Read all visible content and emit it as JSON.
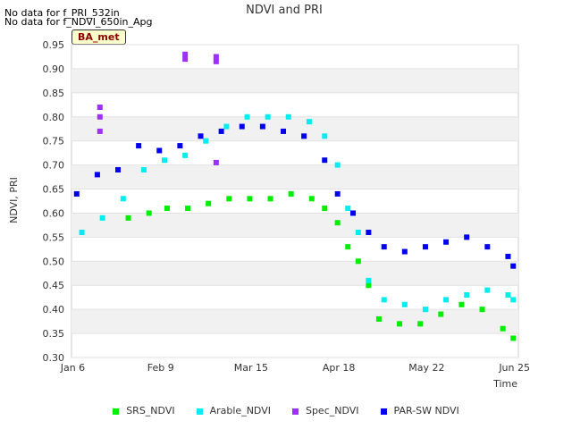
{
  "header": {
    "notes": [
      "No data for f_PRI_532in",
      "No data for f_NDVI_650in_Apg"
    ],
    "badge": "BA_met"
  },
  "chart_data": {
    "type": "scatter",
    "title": "NDVI and PRI",
    "xlabel": "Time",
    "ylabel": "NDVI, PRI",
    "x_ticks": [
      "Jan 6",
      "Feb 9",
      "Mar 15",
      "Apr 18",
      "May 22",
      "Jun 25"
    ],
    "x_range": [
      "2024-01-06",
      "2024-06-27"
    ],
    "ylim": [
      0.3,
      0.95
    ],
    "y_ticks": [
      "0.30",
      "0.35",
      "0.40",
      "0.45",
      "0.50",
      "0.55",
      "0.60",
      "0.65",
      "0.70",
      "0.75",
      "0.80",
      "0.85",
      "0.90",
      "0.95"
    ],
    "grid": "horizontal alternating bands",
    "legend_position": "bottom",
    "series": [
      {
        "name": "SRS_NDVI",
        "color": "#00ee00",
        "x": [
          "2024-01-28",
          "2024-02-05",
          "2024-02-12",
          "2024-02-20",
          "2024-02-28",
          "2024-03-07",
          "2024-03-15",
          "2024-03-23",
          "2024-03-31",
          "2024-04-08",
          "2024-04-13",
          "2024-04-18",
          "2024-04-22",
          "2024-04-26",
          "2024-04-30",
          "2024-05-04",
          "2024-05-12",
          "2024-05-20",
          "2024-05-28",
          "2024-06-05",
          "2024-06-13",
          "2024-06-21",
          "2024-06-25"
        ],
        "y": [
          0.59,
          0.6,
          0.61,
          0.61,
          0.62,
          0.63,
          0.63,
          0.63,
          0.64,
          0.63,
          0.61,
          0.58,
          0.53,
          0.5,
          0.45,
          0.38,
          0.37,
          0.37,
          0.39,
          0.41,
          0.4,
          0.36,
          0.34
        ]
      },
      {
        "name": "Arable_NDVI",
        "color": "#00eeee",
        "x": [
          "2024-01-10",
          "2024-01-18",
          "2024-01-26",
          "2024-02-03",
          "2024-02-11",
          "2024-02-19",
          "2024-02-27",
          "2024-03-06",
          "2024-03-14",
          "2024-03-22",
          "2024-03-30",
          "2024-04-07",
          "2024-04-13",
          "2024-04-18",
          "2024-04-22",
          "2024-04-26",
          "2024-04-30",
          "2024-05-06",
          "2024-05-14",
          "2024-05-22",
          "2024-05-30",
          "2024-06-07",
          "2024-06-15",
          "2024-06-23",
          "2024-06-25"
        ],
        "y": [
          0.56,
          0.59,
          0.63,
          0.69,
          0.71,
          0.72,
          0.75,
          0.78,
          0.8,
          0.8,
          0.8,
          0.79,
          0.76,
          0.7,
          0.61,
          0.56,
          0.46,
          0.42,
          0.41,
          0.4,
          0.42,
          0.43,
          0.44,
          0.43,
          0.42
        ]
      },
      {
        "name": "Spec_NDVI",
        "color": "#9b30ff",
        "x": [
          "2024-01-17",
          "2024-01-17",
          "2024-01-17",
          "2024-02-19",
          "2024-02-19",
          "2024-03-02",
          "2024-03-02",
          "2024-03-02"
        ],
        "y": [
          0.82,
          0.8,
          0.77,
          0.93,
          0.92,
          0.925,
          0.915,
          0.705
        ]
      },
      {
        "name": "PAR-SW NDVI",
        "color": "#0000ee",
        "x": [
          "2024-01-08",
          "2024-01-16",
          "2024-01-24",
          "2024-02-01",
          "2024-02-09",
          "2024-02-17",
          "2024-02-25",
          "2024-03-04",
          "2024-03-12",
          "2024-03-20",
          "2024-03-28",
          "2024-04-05",
          "2024-04-13",
          "2024-04-18",
          "2024-04-24",
          "2024-04-30",
          "2024-05-06",
          "2024-05-14",
          "2024-05-22",
          "2024-05-30",
          "2024-06-07",
          "2024-06-15",
          "2024-06-23",
          "2024-06-25"
        ],
        "y": [
          0.64,
          0.68,
          0.69,
          0.74,
          0.73,
          0.74,
          0.76,
          0.77,
          0.78,
          0.78,
          0.77,
          0.76,
          0.71,
          0.64,
          0.6,
          0.56,
          0.53,
          0.52,
          0.53,
          0.54,
          0.55,
          0.53,
          0.51,
          0.49
        ]
      }
    ]
  }
}
